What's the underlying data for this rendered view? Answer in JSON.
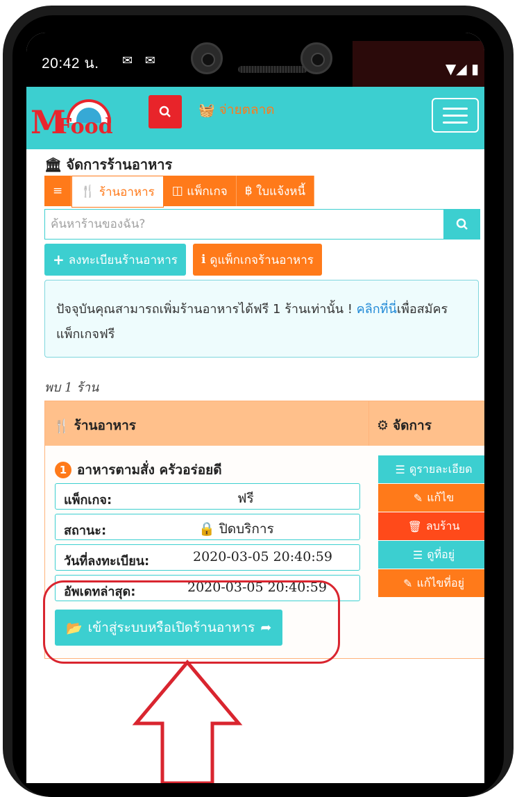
{
  "status": {
    "time": "20:42 น.",
    "left_icons": "✉ ✉"
  },
  "navbar": {
    "logo_m": "M",
    "logo_food": "Food",
    "market_label": "จ่ายตลาด"
  },
  "page": {
    "title": "จัดการร้านอาหาร",
    "tabs": [
      {
        "label": ""
      },
      {
        "label": "ร้านอาหาร"
      },
      {
        "label": "แพ็กเกจ"
      },
      {
        "label": "ใบแจ้งหนี้"
      }
    ],
    "search_placeholder": "ค้นหาร้านของฉัน?",
    "register_button": "ลงทะเบียนร้านอาหาร",
    "package_button": "ดูแพ็กเกจร้านอาหาร",
    "info_text_1": "ปัจจุบันคุณสามารถเพิ่มร้านอาหารได้ฟรี 1 ร้านเท่านั้น ! ",
    "info_link": "คลิกที่นี่",
    "info_text_2": "เพื่อสมัครแพ็กเกจฟรี",
    "found_count": "พบ 1 ร้าน"
  },
  "table": {
    "col_shop": "ร้านอาหาร",
    "col_manage": "จัดการ",
    "row": {
      "number": "1",
      "name": "อาหารตามสั่ง ครัวอร่อยดี",
      "package_label": "แพ็กเกจ:",
      "package_value": "ฟรี",
      "status_label": "สถานะ:",
      "status_value": "ปิดบริการ",
      "registered_label": "วันที่ลงทะเบียน:",
      "registered_value": "2020-03-05 20:40:59",
      "updated_label": "อัพเดทล่าสุด:",
      "updated_value": "2020-03-05 20:40:59",
      "enter_button": "เข้าสู่ระบบหรือเปิดร้านอาหาร"
    },
    "actions": {
      "details": "ดูรายละเอียด",
      "edit": "แก้ไข",
      "delete": "ลบร้าน",
      "view_address": "ดูที่อยู่",
      "edit_address": "แก้ไขที่อยู่"
    }
  },
  "colors": {
    "teal": "#3ccfd0",
    "orange": "#ff7a1a",
    "red": "#e8242a",
    "annotation": "#d9252f"
  }
}
